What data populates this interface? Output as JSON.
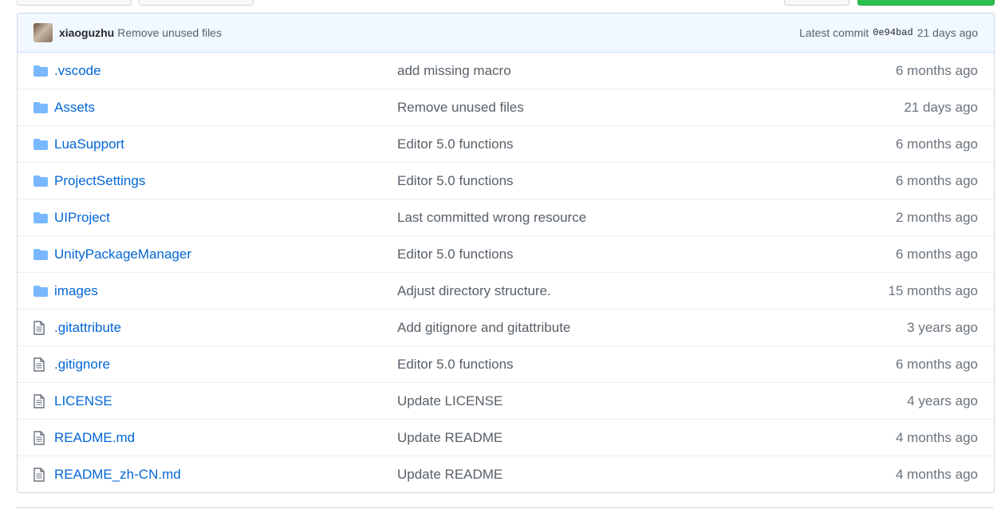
{
  "commit": {
    "author": "xiaoguzhu",
    "message": "Remove unused files",
    "latest_label": "Latest commit",
    "sha": "0e94bad",
    "age": "21 days ago"
  },
  "files": [
    {
      "type": "folder",
      "name": ".vscode",
      "message": "add missing macro",
      "age": "6 months ago"
    },
    {
      "type": "folder",
      "name": "Assets",
      "message": "Remove unused files",
      "age": "21 days ago"
    },
    {
      "type": "folder",
      "name": "LuaSupport",
      "message": "Editor 5.0 functions",
      "age": "6 months ago"
    },
    {
      "type": "folder",
      "name": "ProjectSettings",
      "message": "Editor 5.0 functions",
      "age": "6 months ago"
    },
    {
      "type": "folder",
      "name": "UIProject",
      "message": "Last committed wrong resource",
      "age": "2 months ago"
    },
    {
      "type": "folder",
      "name": "UnityPackageManager",
      "message": "Editor 5.0 functions",
      "age": "6 months ago"
    },
    {
      "type": "folder",
      "name": "images",
      "message": "Adjust directory structure.",
      "age": "15 months ago"
    },
    {
      "type": "file",
      "name": ".gitattribute",
      "message": "Add gitignore and gitattribute",
      "age": "3 years ago"
    },
    {
      "type": "file",
      "name": ".gitignore",
      "message": "Editor 5.0 functions",
      "age": "6 months ago"
    },
    {
      "type": "file",
      "name": "LICENSE",
      "message": "Update LICENSE",
      "age": "4 years ago"
    },
    {
      "type": "file",
      "name": "README.md",
      "message": "Update README",
      "age": "4 months ago"
    },
    {
      "type": "file",
      "name": "README_zh-CN.md",
      "message": "Update README",
      "age": "4 months ago"
    }
  ],
  "colors": {
    "link": "#0366d6",
    "folder_icon": "#79b8ff",
    "file_icon": "#6a737d",
    "commit_bar_bg": "#f1f8ff"
  }
}
